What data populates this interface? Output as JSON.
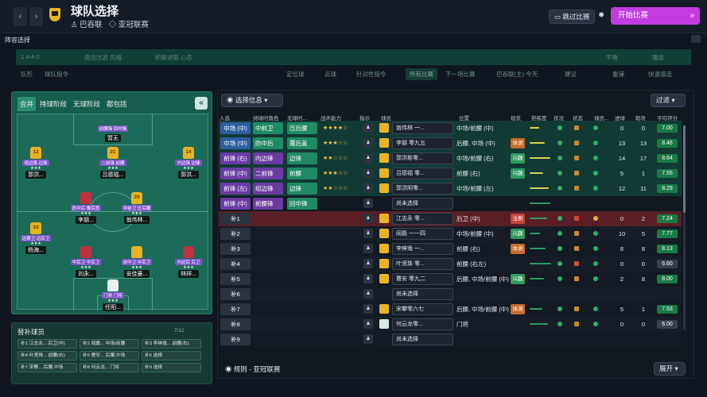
{
  "header": {
    "back_icon": "‹",
    "forward_icon": "›",
    "title": "球队选择",
    "team": "巴吞联",
    "competition": "亚冠联赛",
    "skip_label": "跳过比赛",
    "start_label": "开始比赛"
  },
  "panel": {
    "title": "阵容选择"
  },
  "toolbar1": [
    "1 4-4-2",
    "高位压迫 风格",
    "积极进取 心态",
    "阵容",
    "平衡",
    "强度"
  ],
  "toolbar2": [
    "队形",
    "球队指令",
    "定位球",
    "点球",
    "针对性指令",
    "所有比赛",
    "下一场比赛",
    "巴吞联(主)  今天",
    "建议",
    "重铺",
    "快速填选"
  ],
  "tabs": [
    "合并",
    "持球阶段",
    "无球阶段",
    "都包括"
  ],
  "collapse_icon": "«",
  "pitch_players": [
    {
      "role": "前腰锋 回中锋",
      "name": "暂无",
      "kind": "empty"
    },
    {
      "num": "12",
      "role": "组边锋 边锋",
      "stars": "★★★",
      "name": "郭洪..."
    },
    {
      "num": "21",
      "role": "二前锋 前腰",
      "stars": "★★★",
      "name": "吕德福..."
    },
    {
      "num": "14",
      "role": "内边锋 边锋",
      "stars": "★★★",
      "name": "郭洪..."
    },
    {
      "num": "",
      "role": "防中后 覆后盖",
      "stars": "★★★",
      "name": "李朋..."
    },
    {
      "num": "29",
      "role": "中前卫 压后腰",
      "stars": "★★★",
      "name": "翁伟林..."
    },
    {
      "num": "10",
      "role": "边翼卫 边后卫",
      "stars": "★★★",
      "name": "杨海..."
    },
    {
      "num": "",
      "role": "中后卫 中后卫",
      "stars": "★★★",
      "name": "刘永..."
    },
    {
      "num": "",
      "role": "前中卫 中后卫",
      "stars": "★★★",
      "name": "安佳豪..."
    },
    {
      "num": "",
      "role": "内边后 后卫",
      "stars": "★★★",
      "name": "林祥..."
    },
    {
      "num": "",
      "role": "门将 门将",
      "stars": "★★★",
      "name": "任阳..."
    }
  ],
  "subs": {
    "title": "替补球员",
    "count": "7/12",
    "chips": [
      "补1 江志永...  后卫(中)",
      "补2 阎磊...  中场/前腰",
      "补3 李绅逸...  前腰(右)",
      "补4 叶贤珠...  前腰(右)",
      "补5 曹安...  后腰,中场",
      "补6 选择",
      "补7 宋攀...  后腰,中场",
      "补8 何云龙...  门将",
      "补9 选择"
    ]
  },
  "list": {
    "info_label": "选择信息",
    "filter_label": "过滤",
    "headers": [
      "入选",
      "持球时角色",
      "无球时...",
      "战术能力",
      "指示",
      "球员",
      "位置",
      "现状",
      "熟练度",
      "状况",
      "状态",
      "球员...",
      "进球",
      "助攻",
      "平均评分"
    ],
    "rows": [
      {
        "pos": "中场 (中)",
        "r1": "中前卫",
        "r2": "压后腰",
        "stars": "★★★★☆",
        "player": "翁伟林 一...",
        "ppos": "中场/前腰 (中)",
        "form": "",
        "goals": "0",
        "assists": "0",
        "rating": "7.00"
      },
      {
        "pos": "中场 (中)",
        "r1": "防中后",
        "r2": "覆后盖",
        "stars": "★★★☆☆",
        "player": "李朋 零九五",
        "ppos": "后腰, 中场 (中)",
        "form": "体测",
        "goals": "13",
        "assists": "13",
        "rating": "8.46"
      },
      {
        "pos": "前锋 (右)",
        "r1": "内边锋",
        "r2": "边锋",
        "stars": "★★☆☆☆",
        "player": "郭洪彬零...",
        "ppos": "中场/前腰 (右)",
        "form": "兴趣",
        "goals": "14",
        "assists": "17",
        "rating": "8.64"
      },
      {
        "pos": "前锋 (中)",
        "r1": "二前锋",
        "r2": "前腰",
        "stars": "★★★☆☆",
        "player": "吕德福 零...",
        "ppos": "前腰 (右)",
        "form": "兴趣",
        "goals": "5",
        "assists": "1",
        "rating": "7.55"
      },
      {
        "pos": "前锋 (左)",
        "r1": "组边锋",
        "r2": "边锋",
        "stars": "★★☆☆☆",
        "player": "郭洪明零...",
        "ppos": "中场/前腰 (左)",
        "form": "",
        "goals": "12",
        "assists": "11",
        "rating": "8.29"
      },
      {
        "pos": "前锋 (中)",
        "r1": "前腰锋",
        "r2": "回中锋",
        "stars": "",
        "player": "尚未选择",
        "ppos": "",
        "form": "",
        "goals": "",
        "assists": "",
        "rating": ""
      },
      {
        "pos": "补1",
        "r1": "",
        "r2": "",
        "stars": "",
        "player": "江志永 零...",
        "ppos": "后卫 (中)",
        "form": "注册",
        "goals": "0",
        "assists": "2",
        "rating": "7.24"
      },
      {
        "pos": "补2",
        "r1": "",
        "r2": "",
        "stars": "",
        "player": "阎磊 一一四",
        "ppos": "中场/前腰 (中)",
        "form": "兴趣",
        "goals": "10",
        "assists": "5",
        "rating": "7.77"
      },
      {
        "pos": "补3",
        "r1": "",
        "r2": "",
        "stars": "",
        "player": "李绅逸 一...",
        "ppos": "前腰 (右)",
        "form": "体测",
        "goals": "8",
        "assists": "8",
        "rating": "8.13"
      },
      {
        "pos": "补4",
        "r1": "",
        "r2": "",
        "stars": "",
        "player": "叶贤珠 零...",
        "ppos": "前腰 (右左)",
        "form": "",
        "goals": "0",
        "assists": "0",
        "rating": "6.60"
      },
      {
        "pos": "补5",
        "r1": "",
        "r2": "",
        "stars": "",
        "player": "曹安 零九二",
        "ppos": "后腰, 中场/前腰 (中)",
        "form": "兴趣",
        "goals": "2",
        "assists": "8",
        "rating": "8.00"
      },
      {
        "pos": "补6",
        "r1": "",
        "r2": "",
        "stars": "",
        "player": "尚未选择",
        "ppos": "",
        "form": "",
        "goals": "",
        "assists": "",
        "rating": ""
      },
      {
        "pos": "补7",
        "r1": "",
        "r2": "",
        "stars": "",
        "player": "宋攀零六七",
        "ppos": "后腰, 中场/前腰 (中)",
        "form": "体测",
        "goals": "5",
        "assists": "1",
        "rating": "7.53"
      },
      {
        "pos": "补8",
        "r1": "",
        "r2": "",
        "stars": "",
        "player": "何云龙零...",
        "ppos": "门将",
        "form": "",
        "goals": "0",
        "assists": "0",
        "rating": "6.00"
      },
      {
        "pos": "补9",
        "r1": "",
        "r2": "",
        "stars": "",
        "player": "尚未选择",
        "ppos": "",
        "form": "",
        "goals": "",
        "assists": "",
        "rating": ""
      }
    ]
  },
  "footer": {
    "rules_label": "规则 - 亚冠联赛",
    "expand_label": "展开"
  },
  "colors": {
    "accent": "#c13de0",
    "pitch": "#1c6b58",
    "green_pos": "#1f8a63",
    "blue_pos": "#2b5f9e",
    "purple_pos": "#6a3ba3",
    "red_row": "#5a1f26"
  }
}
